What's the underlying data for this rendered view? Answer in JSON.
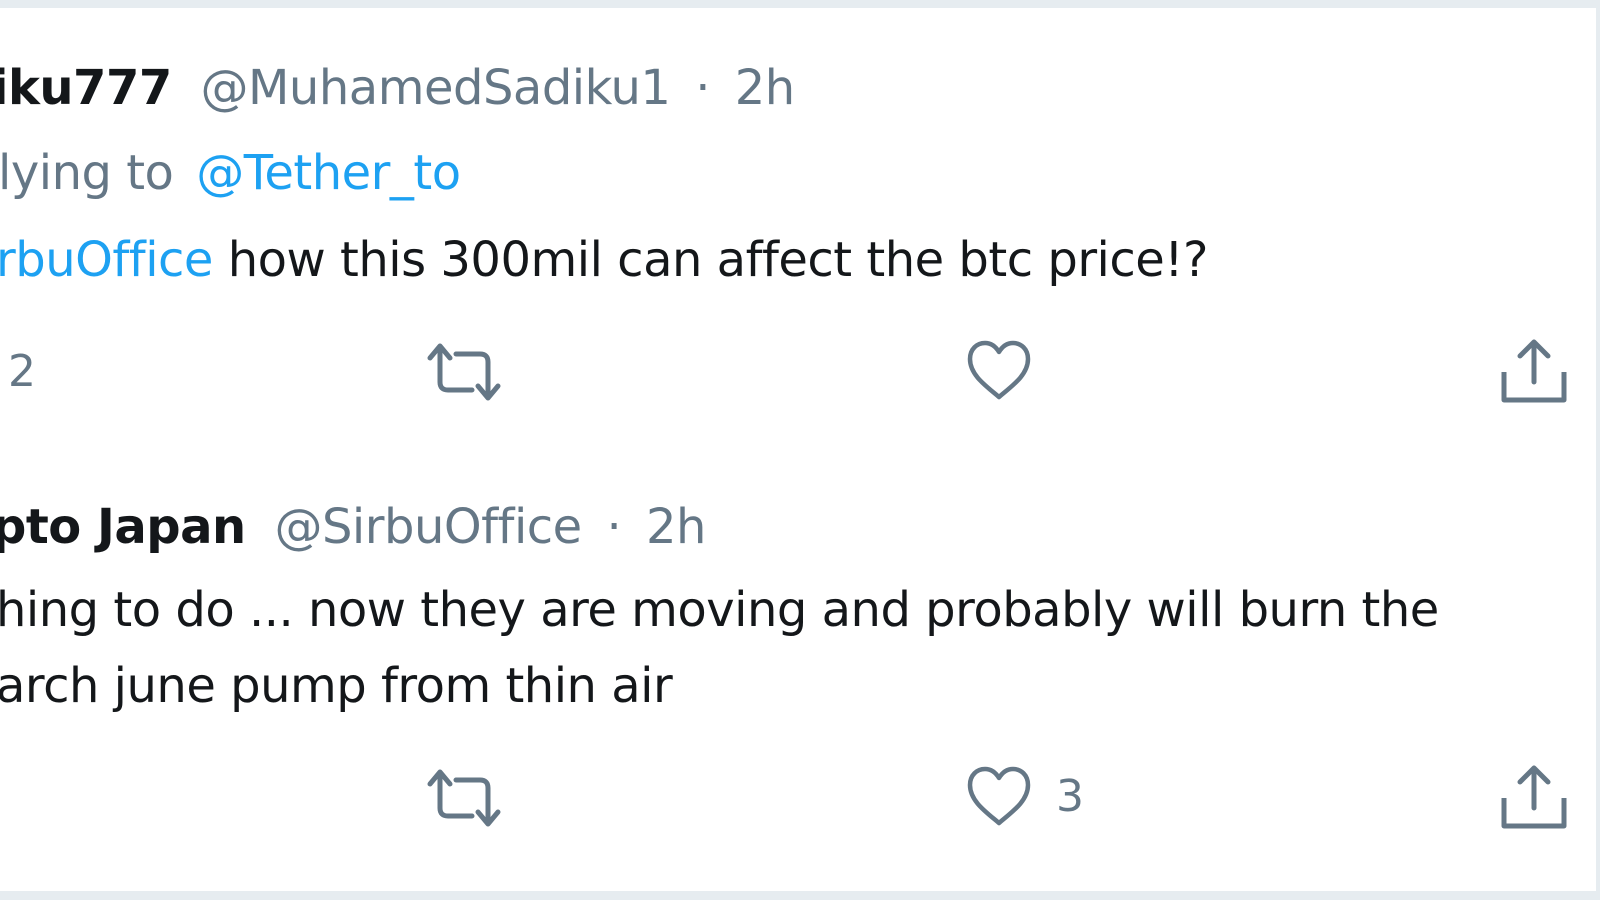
{
  "replies": [
    {
      "display_name": "iku777",
      "handle": "@MuhamedSadiku1",
      "separator": "·",
      "time": "2h",
      "replying_prefix": "lying to",
      "replying_to": "@Tether_to",
      "mention": "rbuOffice",
      "text": " how this 300mil can affect the btc price!?",
      "reply_count": "2",
      "retweet_count": "",
      "like_count": ""
    },
    {
      "display_name": "pto Japan",
      "handle": "@SirbuOffice",
      "separator": "·",
      "time": "2h",
      "text_line1": "hing to do ... now they are moving and probably will burn the",
      "text_line2": "arch june pump from thin air",
      "reply_count": "",
      "retweet_count": "",
      "like_count": "3"
    }
  ],
  "icons": {
    "reply": "reply-icon",
    "retweet": "retweet-icon",
    "like": "heart-icon",
    "share": "share-icon"
  },
  "colors": {
    "link": "#1da1f2",
    "muted": "#657786",
    "text": "#14171a",
    "border": "#e6ecf0"
  }
}
